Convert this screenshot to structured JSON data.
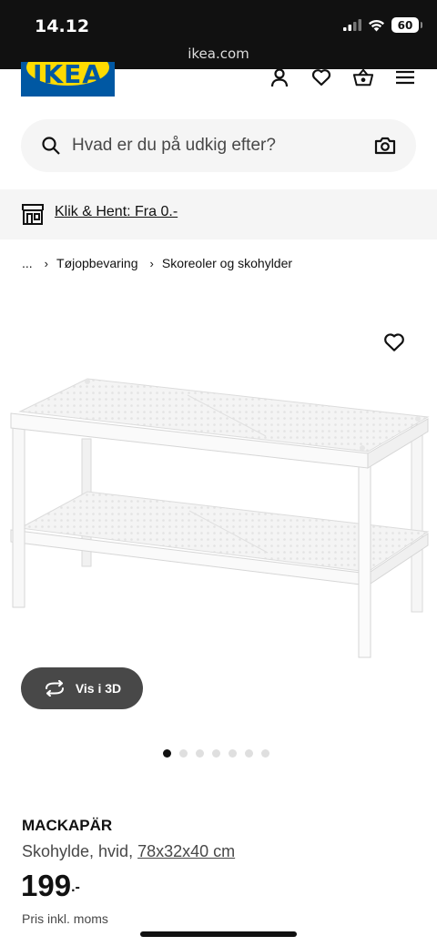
{
  "status_bar": {
    "time": "14.12",
    "battery": "60",
    "url": "ikea.com"
  },
  "header": {
    "logo_text": "IKEA",
    "icons": [
      "account-icon",
      "heart-icon",
      "shopping-bag-icon",
      "hamburger-menu-icon"
    ]
  },
  "search": {
    "placeholder": "Hvad er du på udkig efter?"
  },
  "pickup": {
    "text": "Klik & Hent: Fra 0.-"
  },
  "breadcrumb": {
    "ellipsis": "...",
    "items": [
      "Tøjopbevaring",
      "Skoreoler og skohylder"
    ]
  },
  "gallery": {
    "view3d_label": "Vis i 3D",
    "dot_count": 7,
    "active_index": 0
  },
  "product": {
    "name": "MACKAPÄR",
    "desc_prefix": "Skohylde, hvid, ",
    "dimensions": "78x32x40 cm",
    "price": "199",
    "price_suffix": ".-",
    "price_note": "Pris inkl. moms"
  },
  "colors": {
    "ikea_blue": "#0058a3",
    "ikea_yellow": "#ffdb00",
    "button_dark": "#484848"
  }
}
